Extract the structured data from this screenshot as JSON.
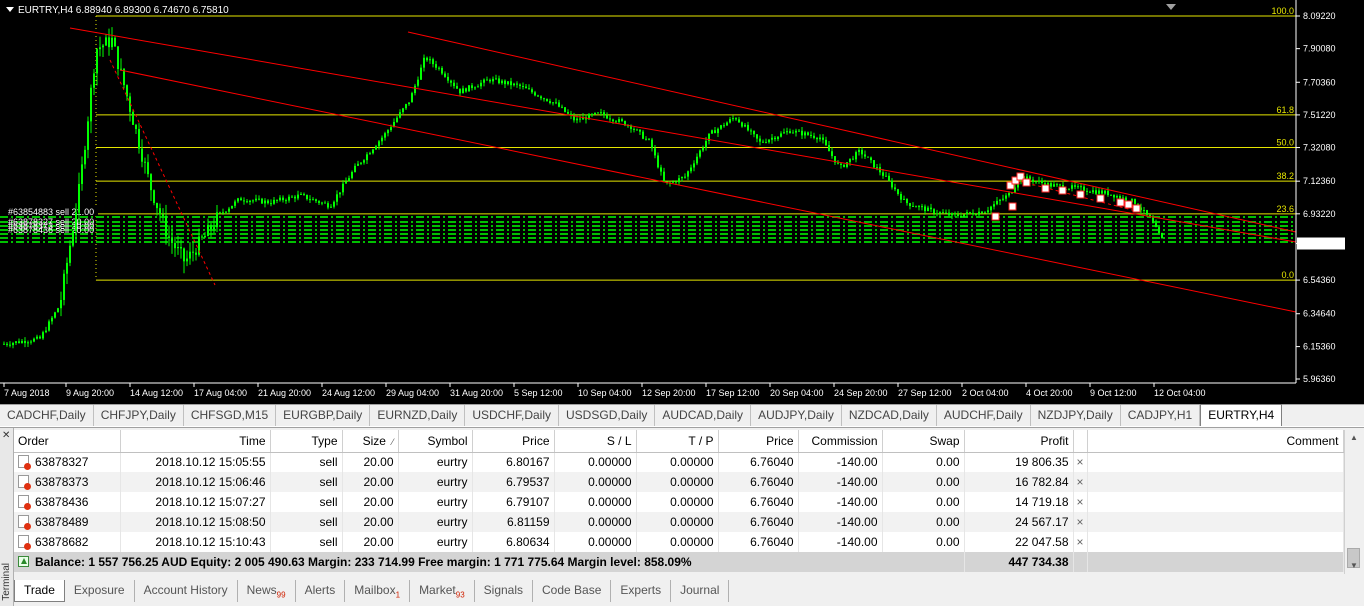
{
  "chart": {
    "info_text": "EURTRY,H4  6.88940 6.89300 6.74670 6.75810",
    "price_labels": [
      "8.09220",
      "7.90080",
      "7.70360",
      "7.51220",
      "7.32080",
      "7.12360",
      "6.93220",
      "6.75810",
      "6.54360",
      "6.34640",
      "6.15360",
      "5.96360"
    ],
    "current_price": "6.75810",
    "time_labels": [
      "7 Aug 2018",
      "9 Aug 20:00",
      "14 Aug 12:00",
      "17 Aug 04:00",
      "21 Aug 20:00",
      "24 Aug 12:00",
      "29 Aug 04:00",
      "31 Aug 20:00",
      "5 Sep 12:00",
      "10 Sep 04:00",
      "12 Sep 20:00",
      "17 Sep 12:00",
      "20 Sep 04:00",
      "24 Sep 20:00",
      "27 Sep 12:00",
      "2 Oct 04:00",
      "4 Oct 20:00",
      "9 Oct 12:00",
      "12 Oct 04:00"
    ],
    "fib_levels": [
      "100.0",
      "61.8",
      "50.0",
      "38.2",
      "23.6",
      "0.0"
    ],
    "order_overlay_top": "#63854883 sell 21.00",
    "order_overlay_stack": [
      "#63878327 sell 20.00",
      "#63878373 sell 20.00",
      "#63878436 sell 20.00"
    ],
    "colors": {
      "background": "#000000",
      "candles": "#00ff00",
      "trendline": "#ff0000",
      "fibonacci": "#e6e600",
      "order_lines": "#00c000"
    }
  },
  "symbol_tabs": [
    {
      "label": "CADCHF,Daily"
    },
    {
      "label": "CHFJPY,Daily"
    },
    {
      "label": "CHFSGD,M15"
    },
    {
      "label": "EURGBP,Daily"
    },
    {
      "label": "EURNZD,Daily"
    },
    {
      "label": "USDCHF,Daily"
    },
    {
      "label": "USDSGD,Daily"
    },
    {
      "label": "AUDCAD,Daily"
    },
    {
      "label": "AUDJPY,Daily"
    },
    {
      "label": "NZDCAD,Daily"
    },
    {
      "label": "AUDCHF,Daily"
    },
    {
      "label": "NZDJPY,Daily"
    },
    {
      "label": "CADJPY,H1"
    },
    {
      "label": "EURTRY,H4",
      "active": true
    }
  ],
  "terminal": {
    "label": "Terminal",
    "close_glyph": "✕",
    "columns": [
      "Order",
      "Time",
      "Type",
      "Size",
      "Symbol",
      "Price",
      "S / L",
      "T / P",
      "Price",
      "Commission",
      "Swap",
      "Profit",
      "Comment"
    ],
    "sort_indicator": "⁄",
    "rows": [
      {
        "order": "63878327",
        "time": "2018.10.12 15:05:55",
        "type": "sell",
        "size": "20.00",
        "symbol": "eurtry",
        "price": "6.80167",
        "sl": "0.00000",
        "tp": "0.00000",
        "cur_price": "6.76040",
        "commission": "-140.00",
        "swap": "0.00",
        "profit": "19 806.35"
      },
      {
        "order": "63878373",
        "time": "2018.10.12 15:06:46",
        "type": "sell",
        "size": "20.00",
        "symbol": "eurtry",
        "price": "6.79537",
        "sl": "0.00000",
        "tp": "0.00000",
        "cur_price": "6.76040",
        "commission": "-140.00",
        "swap": "0.00",
        "profit": "16 782.84"
      },
      {
        "order": "63878436",
        "time": "2018.10.12 15:07:27",
        "type": "sell",
        "size": "20.00",
        "symbol": "eurtry",
        "price": "6.79107",
        "sl": "0.00000",
        "tp": "0.00000",
        "cur_price": "6.76040",
        "commission": "-140.00",
        "swap": "0.00",
        "profit": "14 719.18"
      },
      {
        "order": "63878489",
        "time": "2018.10.12 15:08:50",
        "type": "sell",
        "size": "20.00",
        "symbol": "eurtry",
        "price": "6.81159",
        "sl": "0.00000",
        "tp": "0.00000",
        "cur_price": "6.76040",
        "commission": "-140.00",
        "swap": "0.00",
        "profit": "24 567.17"
      },
      {
        "order": "63878682",
        "time": "2018.10.12 15:10:43",
        "type": "sell",
        "size": "20.00",
        "symbol": "eurtry",
        "price": "6.80634",
        "sl": "0.00000",
        "tp": "0.00000",
        "cur_price": "6.76040",
        "commission": "-140.00",
        "swap": "0.00",
        "profit": "22 047.58"
      }
    ],
    "close_x": "×",
    "summary": {
      "text": "Balance: 1 557 756.25 AUD  Equity: 2 005 490.63  Margin: 233 714.99  Free margin: 1 771 775.64  Margin level: 858.09%",
      "total_profit": "447 734.38"
    },
    "tabs": [
      {
        "label": "Trade",
        "active": true
      },
      {
        "label": "Exposure"
      },
      {
        "label": "Account History"
      },
      {
        "label": "News",
        "badge": "99"
      },
      {
        "label": "Alerts"
      },
      {
        "label": "Mailbox",
        "badge": "1"
      },
      {
        "label": "Market",
        "badge": "93"
      },
      {
        "label": "Signals"
      },
      {
        "label": "Code Base"
      },
      {
        "label": "Experts"
      },
      {
        "label": "Journal"
      }
    ]
  }
}
